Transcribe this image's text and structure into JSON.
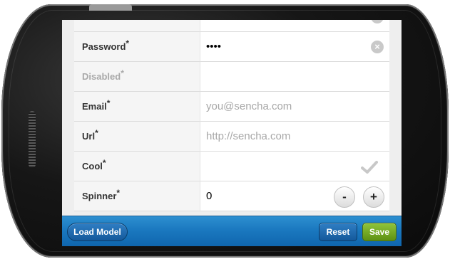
{
  "form": {
    "fields": [
      {
        "label": "Password",
        "required": "*",
        "value": "••••",
        "placeholder": ""
      },
      {
        "label": "Disabled",
        "required": "*",
        "value": "",
        "placeholder": ""
      },
      {
        "label": "Email",
        "required": "*",
        "value": "",
        "placeholder": "you@sencha.com"
      },
      {
        "label": "Url",
        "required": "*",
        "value": "",
        "placeholder": "http://sencha.com"
      },
      {
        "label": "Cool",
        "required": "*",
        "value": "",
        "placeholder": "",
        "checked": true
      },
      {
        "label": "Spinner",
        "required": "*",
        "value": "0",
        "placeholder": ""
      }
    ],
    "spinner_minus": "-",
    "spinner_plus": "+",
    "clear_glyph": "×"
  },
  "toolbar": {
    "load_model": "Load Model",
    "reset": "Reset",
    "save": "Save"
  },
  "colors": {
    "toolbar": "#1a78bf",
    "save": "#6fa31d",
    "label_bg": "#f5f5f5"
  }
}
